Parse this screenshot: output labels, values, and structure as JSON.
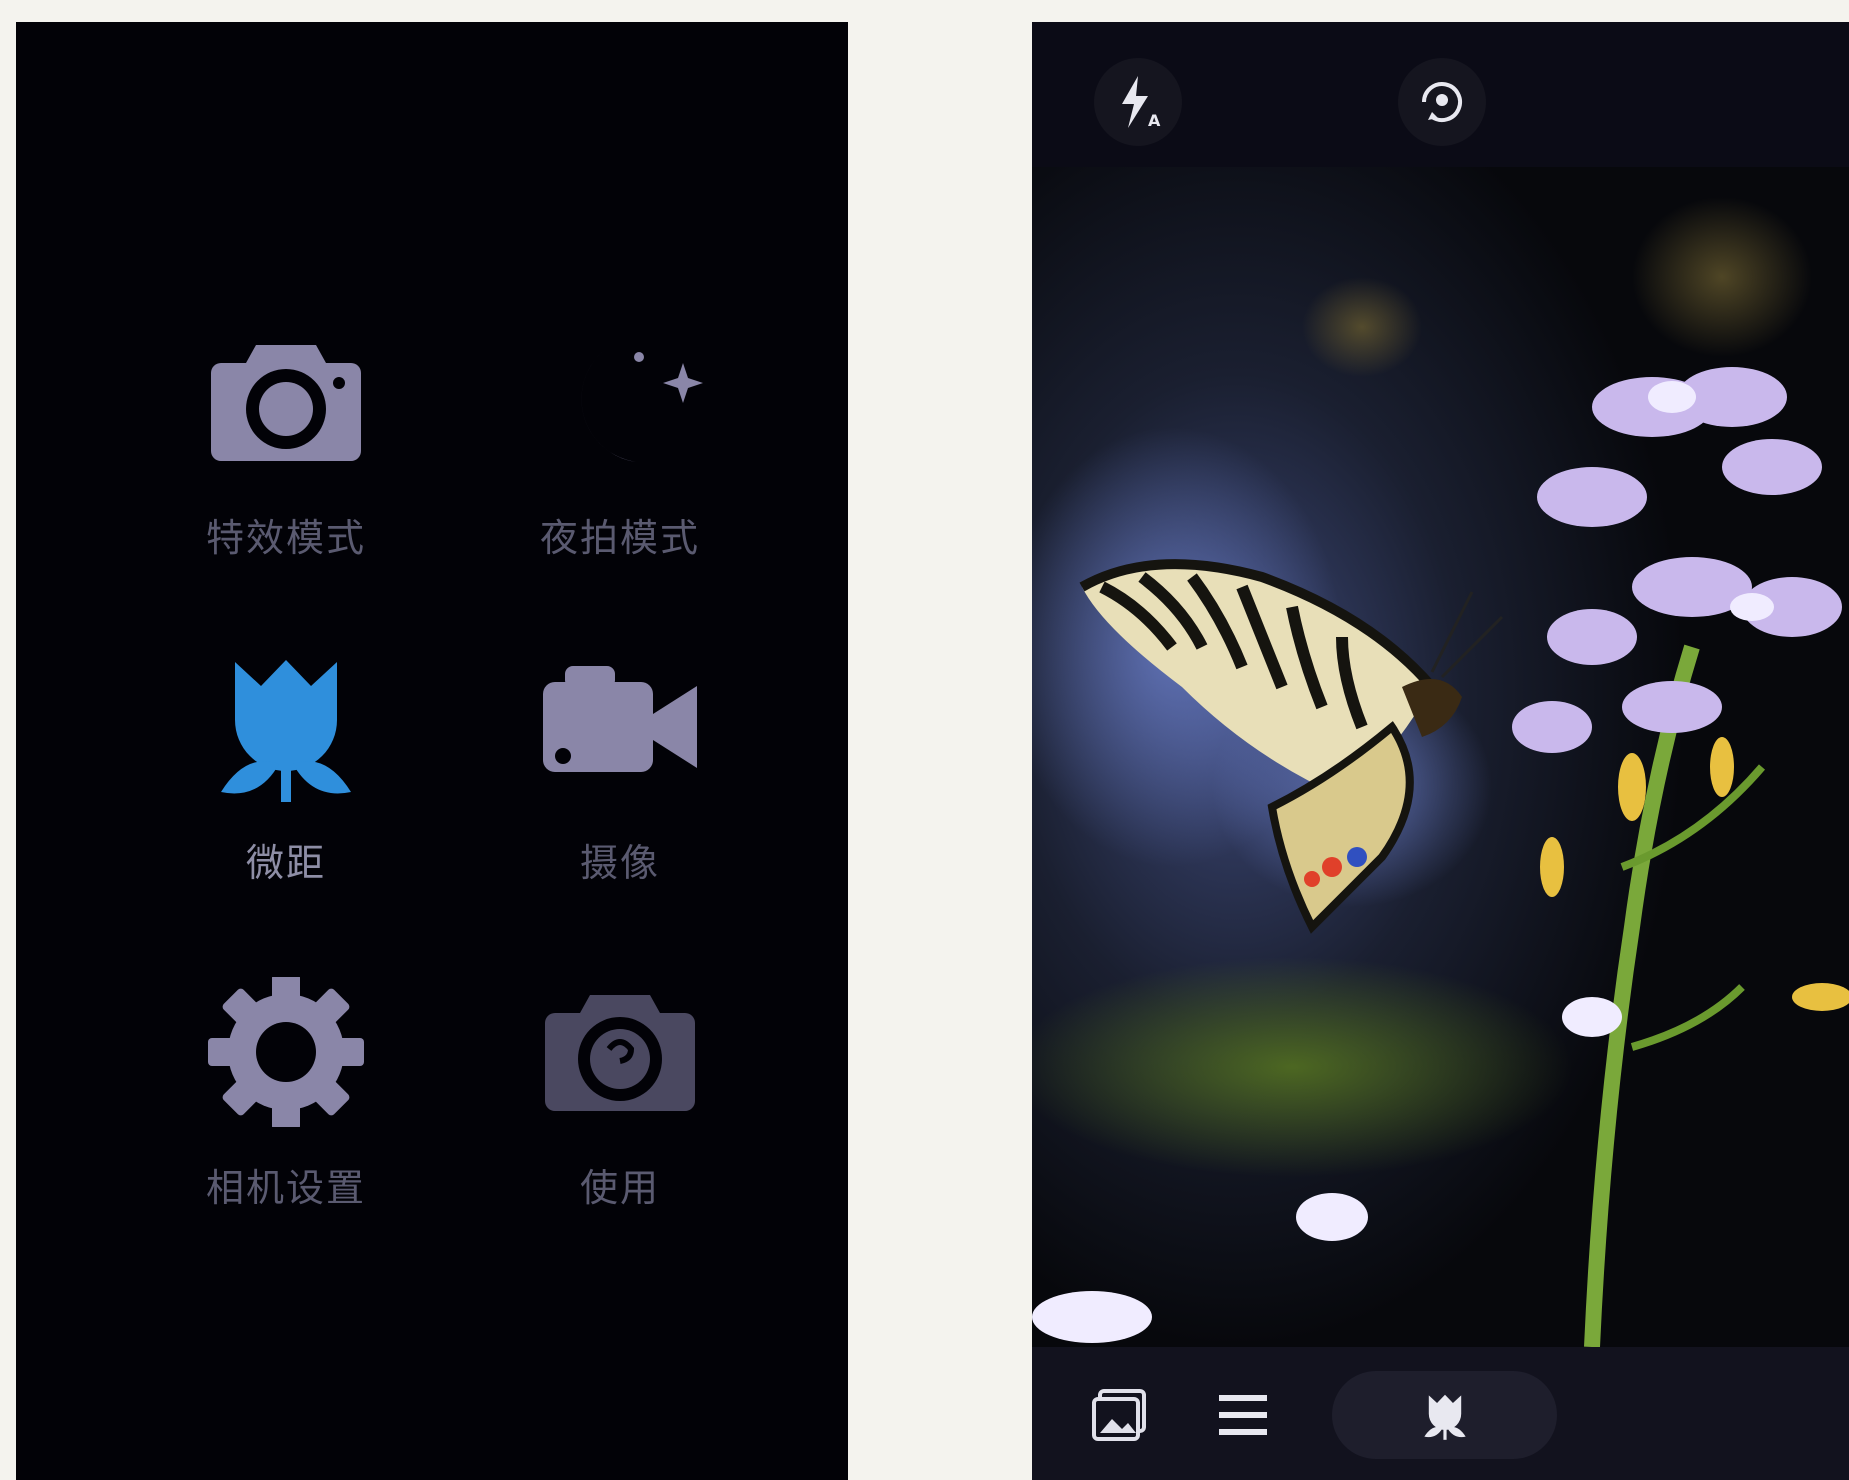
{
  "modes_panel": {
    "items": [
      {
        "id": "effects",
        "label": "特效模式",
        "icon": "camera-icon",
        "active": false
      },
      {
        "id": "night",
        "label": "夜拍模式",
        "icon": "moon-stars-icon",
        "active": false
      },
      {
        "id": "macro",
        "label": "微距",
        "icon": "tulip-icon",
        "active": true
      },
      {
        "id": "video",
        "label": "摄像",
        "icon": "video-camera-icon",
        "active": false
      },
      {
        "id": "settings",
        "label": "相机设置",
        "icon": "gear-icon",
        "active": false
      },
      {
        "id": "usage",
        "label": "使用",
        "icon": "camera-help-icon",
        "active": false
      }
    ]
  },
  "camera_view": {
    "top_bar": {
      "flash_icon": "flash-auto-icon",
      "flip_icon": "switch-camera-icon"
    },
    "bottom_bar": {
      "gallery_icon": "gallery-icon",
      "menu_icon": "menu-icon",
      "mode_icon": "tulip-icon"
    }
  },
  "colors": {
    "inactive_icon": "#8a86a8",
    "active_icon": "#2f8fdc",
    "panel_bg": "#020207"
  }
}
